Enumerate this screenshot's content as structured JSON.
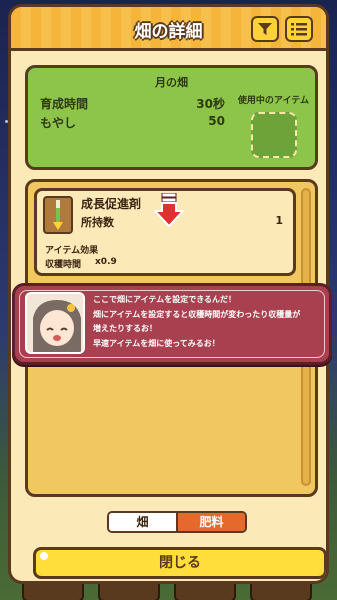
{
  "panel": {
    "title": "畑の詳細"
  },
  "header": {
    "filter_icon": "filter-icon",
    "menu_icon": "list-menu-icon"
  },
  "field_info": {
    "name": "月の畑",
    "growth_time_label": "育成時間",
    "growth_time_value": "30秒",
    "crop_label": "もやし",
    "crop_value": "50",
    "slot_label": "使用中のアイテム"
  },
  "item": {
    "name": "成長促進剤",
    "owned_label": "所持数",
    "owned_value": "1",
    "effect_label": "アイテム効果",
    "harvest_time_label": "収穫時間",
    "harvest_time_value": "x0.9"
  },
  "dialog": {
    "lines": [
      "ここで畑にアイテムを設定できるんだ！",
      "畑にアイテムを設定すると収穫時間が変わったり収穫量が",
      "増えたりするお！",
      "早速アイテムを畑に使ってみるお！"
    ]
  },
  "tabs": {
    "field": "畑",
    "fertilizer": "肥料",
    "active": "fertilizer"
  },
  "close_label": "閉じる",
  "colors": {
    "accent": "#ffdd3a",
    "header": "#f5b53a",
    "dialog": "#a8404f",
    "info_card": "#8cc54a"
  }
}
